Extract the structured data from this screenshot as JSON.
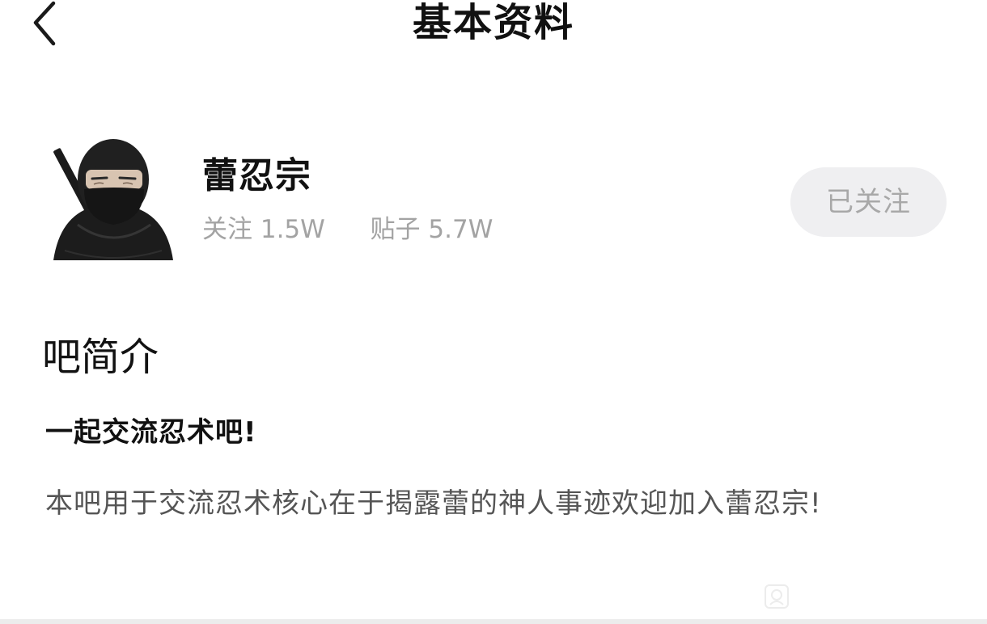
{
  "header": {
    "title": "基本资料",
    "back_icon": "chevron-left-icon"
  },
  "profile": {
    "avatar_icon": "ninja-avatar",
    "name": "蕾忍宗",
    "following_label": "关注",
    "following_count": "1.5W",
    "posts_label": "贴子",
    "posts_count": "5.7W",
    "follow_button_label": "已关注"
  },
  "intro": {
    "section_title": "吧简介",
    "heading": "一起交流忍术吧!",
    "body": "本吧用于交流忍术核心在于揭露蕾的神人事迹欢迎加入蕾忍宗!"
  },
  "colors": {
    "title_text": "#111111",
    "secondary_text": "#a3a3a3",
    "body_text": "#555555",
    "follow_button_bg": "#efeff1",
    "follow_button_text": "#a8a8a8"
  }
}
